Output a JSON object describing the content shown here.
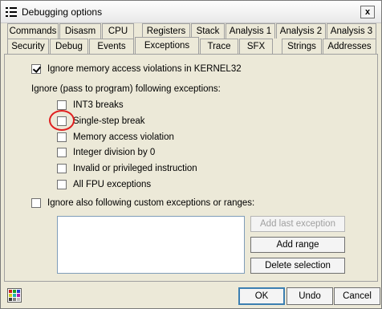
{
  "window": {
    "title": "Debugging options",
    "close_glyph": "x"
  },
  "tabs": {
    "row1": [
      "Commands",
      "Disasm",
      "CPU",
      "Registers",
      "Stack",
      "Analysis 1",
      "Analysis 2",
      "Analysis 3"
    ],
    "row2": [
      "Security",
      "Debug",
      "Events",
      "Exceptions",
      "Trace",
      "SFX",
      "Strings",
      "Addresses"
    ],
    "active": "Exceptions"
  },
  "exceptions": {
    "ignore_kernel32": {
      "label": "Ignore memory access violations in KERNEL32",
      "checked": true
    },
    "group_label": "Ignore (pass to program) following exceptions:",
    "items": [
      {
        "label": "INT3 breaks",
        "checked": false
      },
      {
        "label": "Single-step break",
        "checked": false
      },
      {
        "label": "Memory access violation",
        "checked": false
      },
      {
        "label": "Integer division by 0",
        "checked": false
      },
      {
        "label": "Invalid or privileged instruction",
        "checked": false
      },
      {
        "label": "All FPU exceptions",
        "checked": false
      }
    ],
    "custom": {
      "label": "Ignore also following custom exceptions or ranges:",
      "checked": false
    },
    "buttons": {
      "add_last": "Add last exception",
      "add_range": "Add range",
      "delete_selection": "Delete selection"
    }
  },
  "footer": {
    "ok": "OK",
    "undo": "Undo",
    "cancel": "Cancel"
  },
  "colors": {
    "highlight_circle": "#e02020",
    "default_button_border": "#3c7fb1"
  }
}
